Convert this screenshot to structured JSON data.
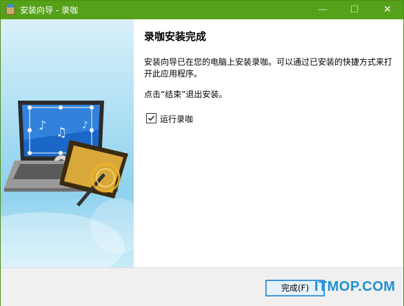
{
  "window": {
    "title": "安装向导 - 录咖",
    "controls": {
      "minimize": "—",
      "maximize": "☐",
      "close": "✕"
    },
    "accent": "#55a11a"
  },
  "content": {
    "heading": "录咖安装完成",
    "description": "安装向导已在您的电脑上安装录咖。可以通过已安装的快捷方式来打开此应用程序。",
    "hint": "点击“结束”退出安装。",
    "run_checkbox": {
      "label": "运行录咖",
      "checked": true
    }
  },
  "footer": {
    "finish_label": "完成(F)",
    "watermark": "ITMOP.COM"
  }
}
